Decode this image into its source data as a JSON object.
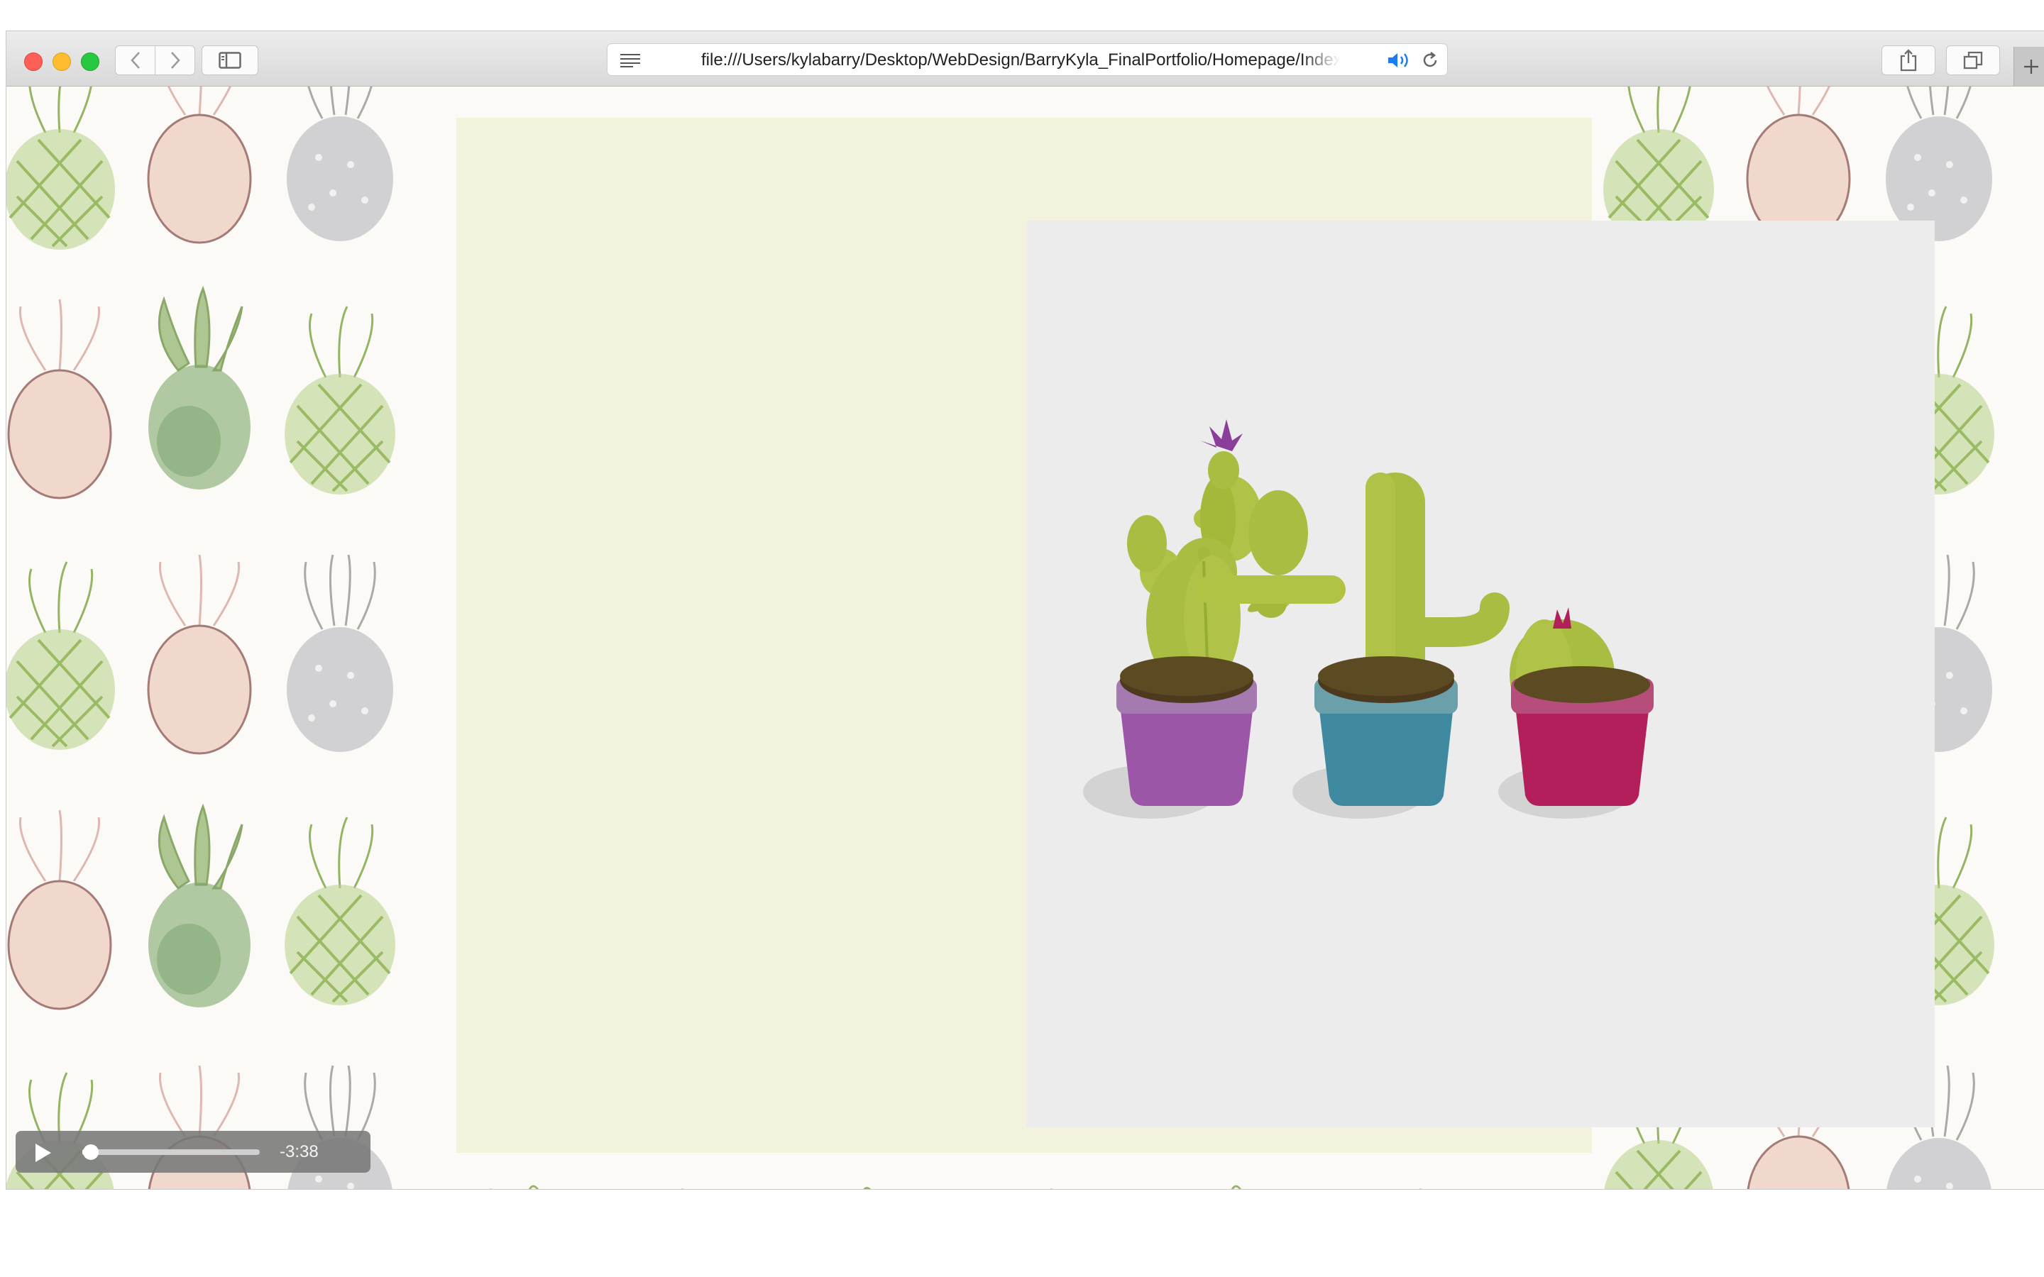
{
  "browser": {
    "url": "file:///Users/kylabarry/Desktop/WebDesign/BarryKyla_FinalPortfolio/Homepage/Index.html",
    "icons": [
      "close-icon",
      "minimize-icon",
      "zoom-icon",
      "back-icon",
      "forward-icon",
      "sidebar-icon",
      "reader-icon",
      "audio-icon",
      "reload-icon",
      "share-icon",
      "tabs-icon",
      "plus-icon"
    ]
  },
  "page": {
    "panel_color": "#f3f3dd",
    "art_background": "#ececec",
    "cactus_pots": [
      {
        "name": "prickly-pear-cactus",
        "pot_color": "#9b56a7"
      },
      {
        "name": "column-cactus",
        "pot_color": "#3f8aa0"
      },
      {
        "name": "barrel-cactus",
        "pot_color": "#b21f5a"
      }
    ]
  },
  "audio_player": {
    "time_remaining": "-3:38",
    "progress": 0.02
  }
}
